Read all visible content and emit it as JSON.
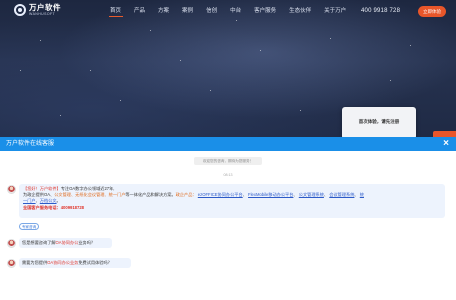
{
  "header": {
    "logo_cn": "万户软件",
    "logo_en": "WANHUSOFT",
    "nav": [
      "首页",
      "产品",
      "方案",
      "案例",
      "信创",
      "中台",
      "客户服务",
      "生态伙伴",
      "关于万户"
    ],
    "active_nav": "首页",
    "phone": "400 9918 728",
    "trial_button": "立即体验"
  },
  "hero": {
    "consult_card_text": "首次体验，请先注册"
  },
  "chat": {
    "title": "万户软件在线客服",
    "close_icon": "close-icon",
    "notice": "欢迎您的咨询，期待为您服务！",
    "timestamp": "08:13",
    "welcome": {
      "intro_bracket": "【您好！万户软件】",
      "intro_rest": "专注OA数字办公领域近27年,",
      "line2_prefix": "为政企提供OA、",
      "line2_orange": "公文管理、无纸化会议管理、统一门户",
      "line2_mid": "等一体化产品和解决方案。",
      "line2_orange2": "政企产品：",
      "link1": "ezOFFICE协同办公平台",
      "link2": "FlexMobile移动办公平台",
      "link3": "公文管理系统",
      "link4": "会议管理系统",
      "link5_part1": "统",
      "link5_part2": "一门户",
      "line3_sep": "、",
      "link6": "万档公文",
      "line3_end": "。",
      "service_label": "全国客户服务电话：",
      "service_phone": "4009918728"
    },
    "quick_reply": "专家咨询",
    "message2_prefix": "您是想要咨询了解",
    "message2_highlight": "OA协同办公",
    "message2_suffix": "业务吗？",
    "message3_prefix": "需要为您提供",
    "message3_highlight": "OA协同办公业务",
    "message3_suffix": "免费试用体验吗？",
    "colors": {
      "header": "#1a8fe8",
      "bubble": "#edf3fd",
      "accent": "#e8562a"
    }
  }
}
